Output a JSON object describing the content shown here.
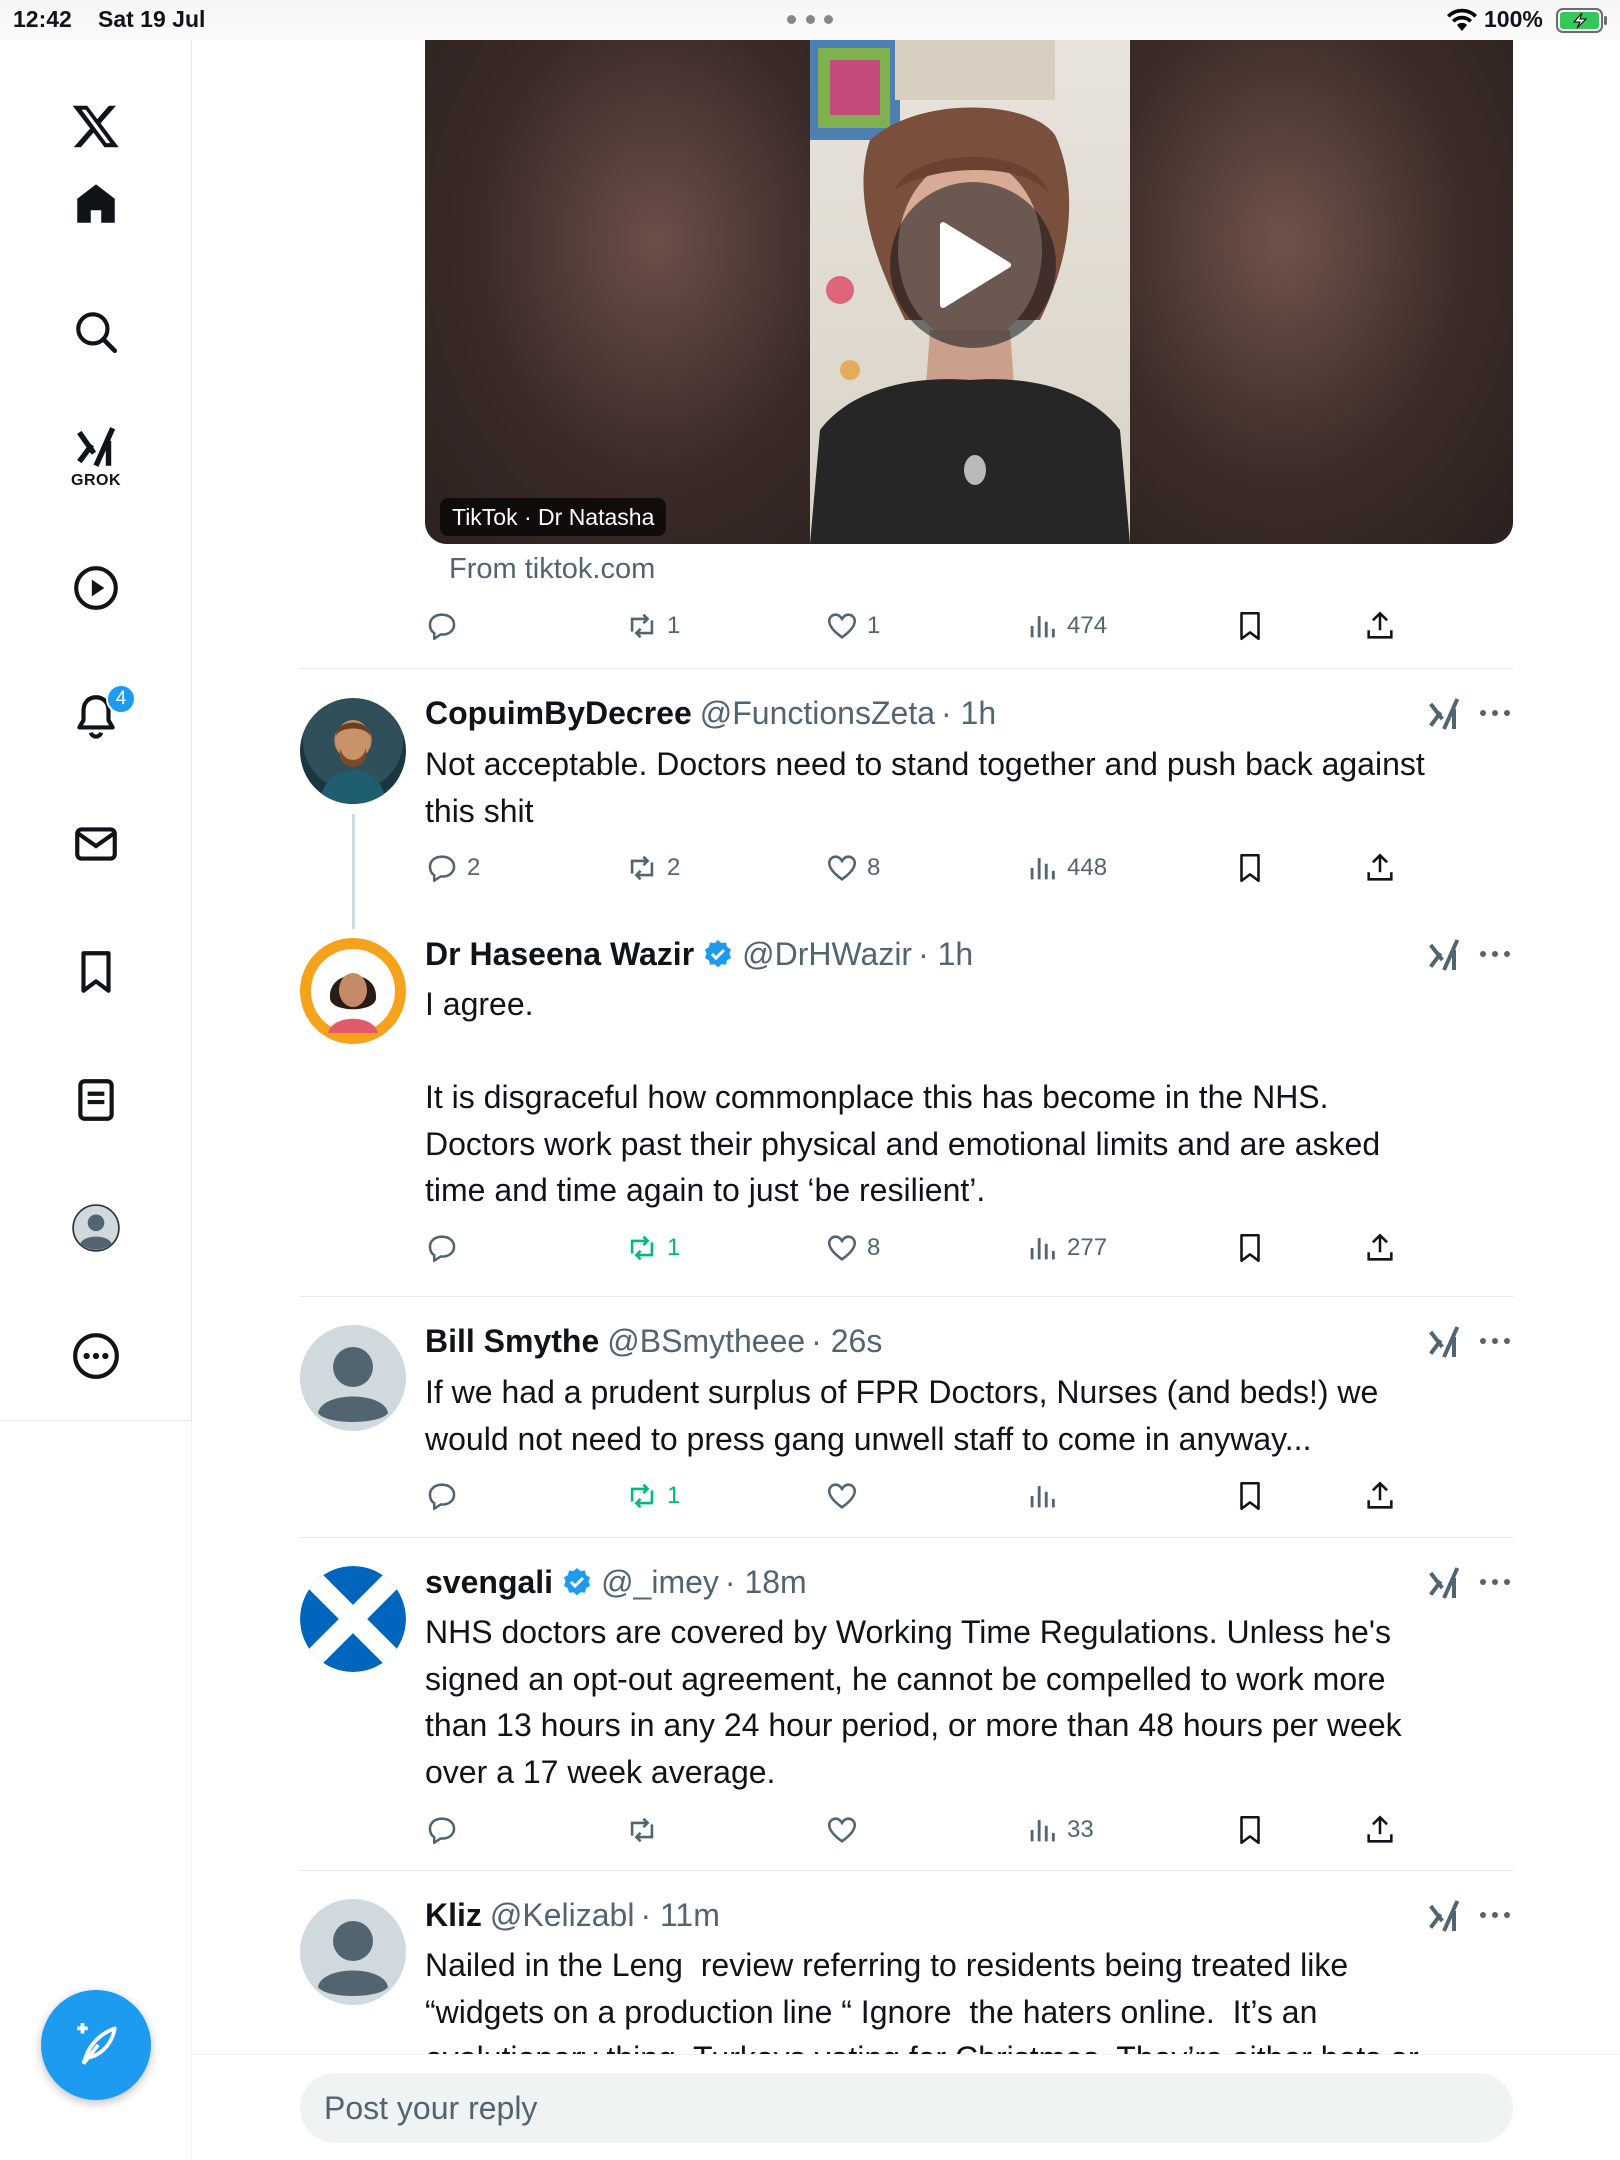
{
  "status_bar": {
    "time": "12:42",
    "date": "Sat 19 Jul",
    "battery": "100%"
  },
  "sidebar": {
    "items": [
      {
        "name": "x-logo-icon"
      },
      {
        "name": "home-icon"
      },
      {
        "name": "search-icon"
      },
      {
        "name": "grok-icon",
        "label": "GROK"
      },
      {
        "name": "video-icon"
      },
      {
        "name": "notifications-icon",
        "badge": "4"
      },
      {
        "name": "messages-icon"
      },
      {
        "name": "bookmarks-icon"
      },
      {
        "name": "lists-icon"
      },
      {
        "name": "profile-icon"
      },
      {
        "name": "more-icon"
      }
    ]
  },
  "video_card": {
    "label": "TikTok · Dr Natasha",
    "source": "From tiktok.com"
  },
  "top_actions": {
    "replies": "",
    "reposts": "1",
    "likes": "1",
    "views": "474"
  },
  "tweets": [
    {
      "name": "CopuimByDecree",
      "handle": "@FunctionsZeta",
      "time": "· 1h",
      "verified": false,
      "text": "Not acceptable. Doctors need to stand together and push back against\nthis shit",
      "replies": "2",
      "reposts": "2",
      "likes": "8",
      "views": "448"
    },
    {
      "name": "Dr Haseena Wazir",
      "handle": "@DrHWazir",
      "time": "· 1h",
      "verified": true,
      "text": "I agree.\n\nIt is disgraceful how commonplace this has become in the NHS.\nDoctors work past their physical and emotional limits and are asked\ntime and time again to just ‘be resilient’.",
      "replies": "",
      "reposts": "1",
      "likes": "8",
      "views": "277"
    },
    {
      "name": "Bill Smythe",
      "handle": "@BSmytheee",
      "time": "· 26s",
      "verified": false,
      "text": "If we had a prudent surplus of FPR Doctors, Nurses (and beds!) we\nwould not need to press gang unwell staff to come in anyway...",
      "replies": "",
      "reposts": "1",
      "likes": "",
      "views": ""
    },
    {
      "name": "svengali",
      "handle": "@_imey",
      "time": "· 18m",
      "verified": true,
      "text": "NHS doctors are covered by Working Time Regulations. Unless he's\nsigned an opt-out agreement, he cannot be compelled to work more\nthan 13 hours in any 24 hour period, or more than 48 hours per week\nover a 17 week average.",
      "replies": "",
      "reposts": "",
      "likes": "",
      "views": "33"
    },
    {
      "name": "Kliz",
      "handle": "@Kelizabl",
      "time": "· 11m",
      "verified": false,
      "text": "Nailed in the Leng  review referring to residents being treated like\n“widgets on a production line “ Ignore  the haters online.  It’s an\nevolutionary thing. Turkeys voting for Christmas. They’re either bots or",
      "replies": "",
      "reposts": "",
      "likes": "",
      "views": ""
    }
  ],
  "reply_bar": {
    "placeholder": "Post your reply"
  },
  "colors": {
    "accent": "#1d9bf0",
    "repost_active": "#00ba7c",
    "muted": "#536471"
  }
}
